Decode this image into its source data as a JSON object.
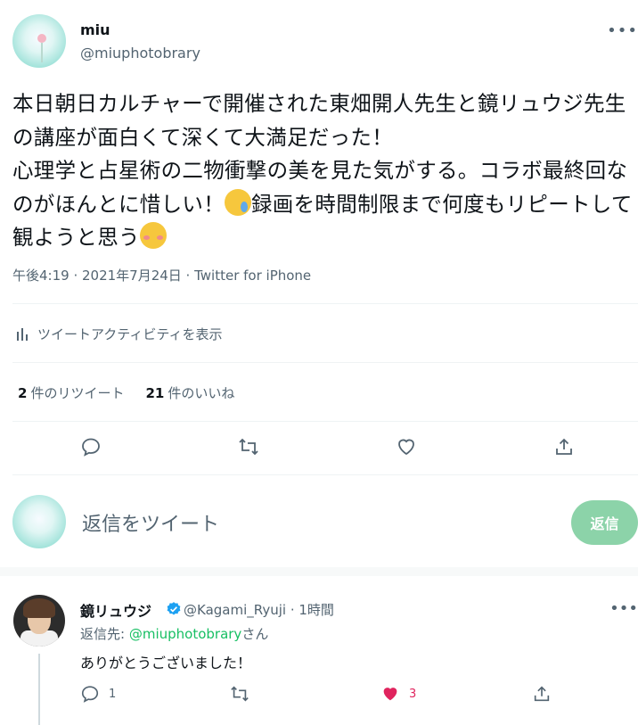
{
  "tweet": {
    "author_name": "miu",
    "author_handle": "@miuphotobrary",
    "text_part1": "本日朝日カルチャーで開催された東畑開人先生と鏡リュウジ先生の講座が面白くて深くて大満足だった！\n心理学と占星術の二物衝撃の美を見た気がする。コラボ最終回なのがほんとに惜しい！",
    "text_part2": "録画を時間制限まで何度もリピートして観ようと思う",
    "meta": "午後4:19 · 2021年7月24日 · Twitter for iPhone",
    "activity_label": "ツイートアクティビティを表示",
    "retweets_count": "2",
    "retweets_label": "件のリツイート",
    "likes_count": "21",
    "likes_label": "件のいいね"
  },
  "compose": {
    "placeholder": "返信をツイート",
    "button_label": "返信"
  },
  "reply": {
    "author_name": "鏡リュウジ",
    "author_handle": "@Kagami_Ryuji · 1時間",
    "reply_to_prefix": "返信先: ",
    "reply_to_handle": "@miuphotobrary",
    "reply_to_suffix": "さん",
    "text": "ありがとうございました！",
    "reply_count": "1",
    "like_count": "3",
    "like_color": "#e0245e"
  },
  "accent": {
    "green": "#17bf63",
    "verified_blue": "#1da1f2"
  },
  "icons": [
    "reply-icon",
    "retweet-icon",
    "like-icon",
    "share-icon",
    "analytics-icon",
    "more-icon",
    "verified-icon"
  ]
}
